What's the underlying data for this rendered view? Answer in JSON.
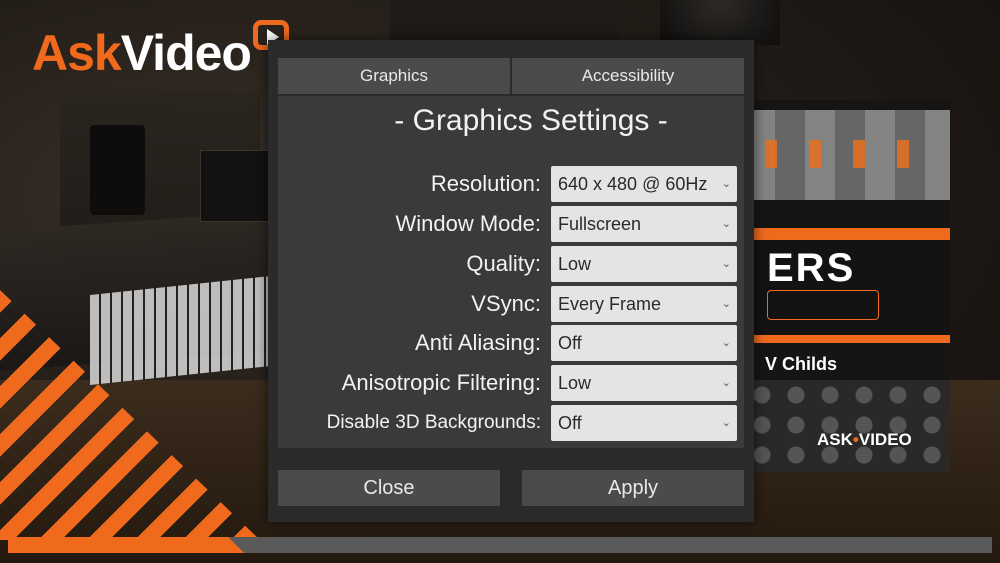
{
  "logo": {
    "ask": "Ask",
    "video": "Video"
  },
  "course_card": {
    "brand": "ERS",
    "author": "V Childs",
    "logo_ask": "ASK",
    "logo_dot": "•",
    "logo_video": "VIDEO"
  },
  "tabs": [
    {
      "label": "Graphics",
      "active": true
    },
    {
      "label": "Accessibility",
      "active": false
    }
  ],
  "panel": {
    "title": "- Graphics Settings -",
    "settings": [
      {
        "label": "Resolution:",
        "value": "640 x 480 @ 60Hz"
      },
      {
        "label": "Window Mode:",
        "value": "Fullscreen"
      },
      {
        "label": "Quality:",
        "value": "Low"
      },
      {
        "label": "VSync:",
        "value": "Every Frame"
      },
      {
        "label": "Anti Aliasing:",
        "value": "Off"
      },
      {
        "label": "Anisotropic Filtering:",
        "value": "Low"
      },
      {
        "label": "Disable 3D Backgrounds:",
        "value": "Off"
      }
    ]
  },
  "buttons": {
    "close": "Close",
    "apply": "Apply"
  },
  "progress": {
    "fraction": 0.24
  },
  "colors": {
    "accent": "#f06a1e",
    "dialog_bg": "#2b2b2b",
    "panel_bg": "#3a3a3a",
    "select_bg": "#e4e4e4"
  },
  "icons": {
    "dropdown": "chevron-down-icon",
    "play": "play-icon"
  }
}
